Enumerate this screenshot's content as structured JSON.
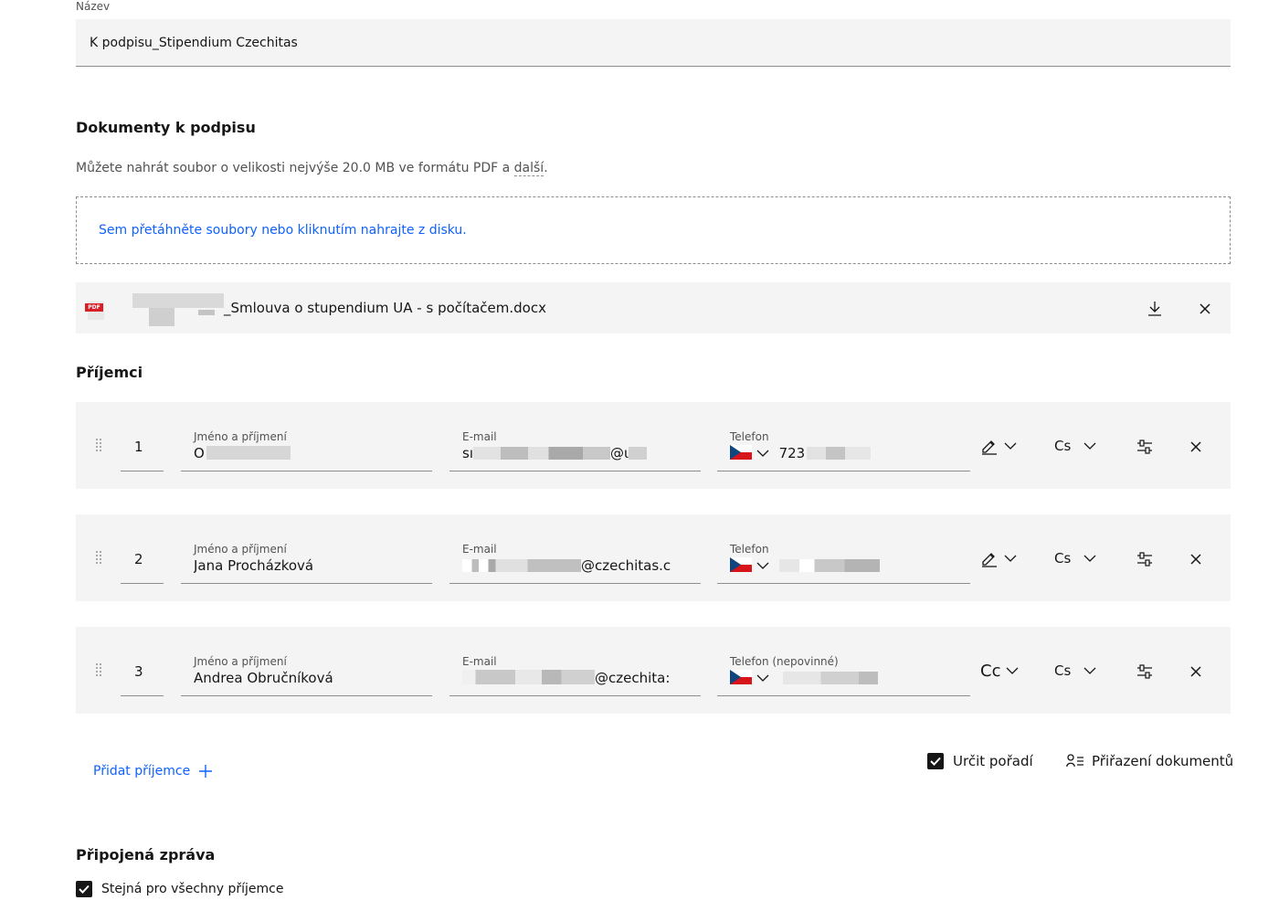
{
  "name_field": {
    "label": "Název",
    "value": "K podpisu_Stipendium Czechitas"
  },
  "documents": {
    "title": "Dokumenty k podpisu",
    "helper_prefix": "Můžete nahrát soubor o velikosti nejvýše 20.0 MB ve formátu PDF a ",
    "helper_link": "další",
    "helper_suffix": ".",
    "dropzone_text": "Sem přetáhněte soubory nebo kliknutím nahrajte z disku.",
    "file": {
      "icon_label": "PDF",
      "name": "_Smlouva o stupendium UA - s počítačem.docx"
    }
  },
  "recipients": {
    "title": "Příjemci",
    "items": [
      {
        "order": "1",
        "name_label": "Jméno a příjmení",
        "name_value": "O",
        "email_label": "E-mail",
        "email_value_start": "sı",
        "email_value_end": "@ι",
        "phone_label": "Telefon",
        "phone_value": "723",
        "role_value": "",
        "lang_value": "Cs"
      },
      {
        "order": "2",
        "name_label": "Jméno a příjmení",
        "name_value": "Jana Procházková",
        "email_label": "E-mail",
        "email_value_start": "",
        "email_value_end": "@czechitas.c",
        "phone_label": "Telefon",
        "phone_value": "",
        "role_value": "",
        "lang_value": "Cs"
      },
      {
        "order": "3",
        "name_label": "Jméno a příjmení",
        "name_value": "Andrea Obručníková",
        "email_label": "E-mail",
        "email_value_start": "",
        "email_value_end": "@czechita:",
        "phone_label": "Telefon (nepovinné)",
        "phone_value": "",
        "role_value": "Cc",
        "lang_value": "Cs"
      }
    ],
    "add_label": "Přidat příjemce",
    "set_order_label": "Určit pořadí",
    "assign_docs_label": "Přiřazení dokumentů"
  },
  "message": {
    "title": "Připojená zpráva",
    "same_for_all_label": "Stejná pro všechny příjemce"
  },
  "colors": {
    "accent": "#0f62fe",
    "field_bg": "#f4f4f4",
    "text": "#161616"
  }
}
